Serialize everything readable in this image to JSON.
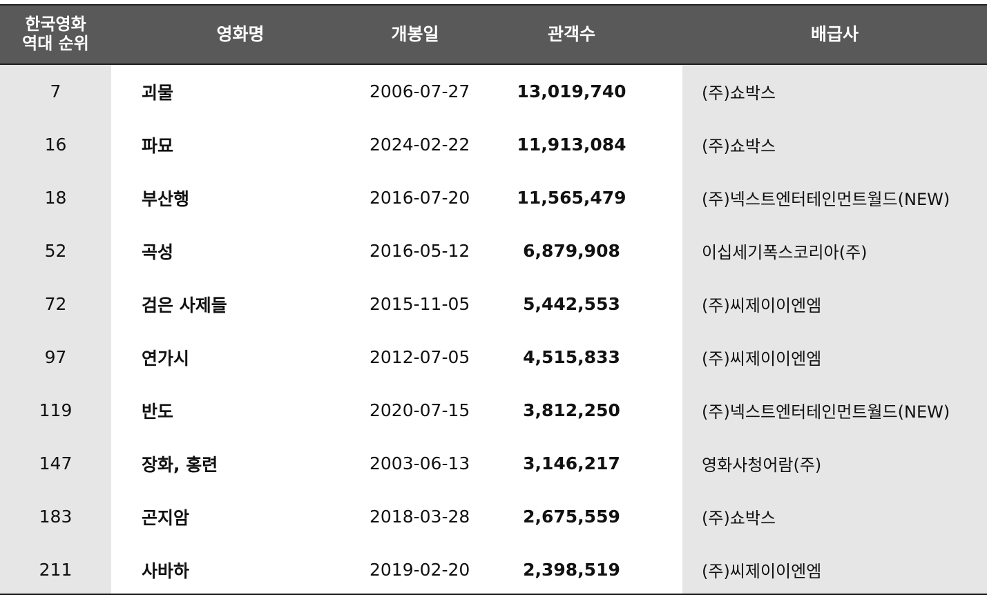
{
  "table": {
    "headers": {
      "rank_line1": "한국영화",
      "rank_line2": "역대 순위",
      "title": "영화명",
      "release_date": "개봉일",
      "audience": "관객수",
      "distributor": "배급사"
    },
    "rows": [
      {
        "rank": "7",
        "title": "괴물",
        "release_date": "2006-07-27",
        "audience": "13,019,740",
        "distributor": "(주)쇼박스"
      },
      {
        "rank": "16",
        "title": "파묘",
        "release_date": "2024-02-22",
        "audience": "11,913,084",
        "distributor": "(주)쇼박스"
      },
      {
        "rank": "18",
        "title": "부산행",
        "release_date": "2016-07-20",
        "audience": "11,565,479",
        "distributor": "(주)넥스트엔터테인먼트월드(NEW)"
      },
      {
        "rank": "52",
        "title": "곡성",
        "release_date": "2016-05-12",
        "audience": "6,879,908",
        "distributor": "이십세기폭스코리아(주)"
      },
      {
        "rank": "72",
        "title": "검은 사제들",
        "release_date": "2015-11-05",
        "audience": "5,442,553",
        "distributor": "(주)씨제이이엔엠"
      },
      {
        "rank": "97",
        "title": "연가시",
        "release_date": "2012-07-05",
        "audience": "4,515,833",
        "distributor": "(주)씨제이이엔엠"
      },
      {
        "rank": "119",
        "title": "반도",
        "release_date": "2020-07-15",
        "audience": "3,812,250",
        "distributor": "(주)넥스트엔터테인먼트월드(NEW)"
      },
      {
        "rank": "147",
        "title": "장화, 홍련",
        "release_date": "2003-06-13",
        "audience": "3,146,217",
        "distributor": "영화사청어람(주)"
      },
      {
        "rank": "183",
        "title": "곤지암",
        "release_date": "2018-03-28",
        "audience": "2,675,559",
        "distributor": "(주)쇼박스"
      },
      {
        "rank": "211",
        "title": "사바하",
        "release_date": "2019-02-20",
        "audience": "2,398,519",
        "distributor": "(주)씨제이이엔엠"
      }
    ]
  },
  "colors": {
    "header_bg": "#595959",
    "shaded_column_bg": "#e7e6e6",
    "border": "#222222"
  }
}
